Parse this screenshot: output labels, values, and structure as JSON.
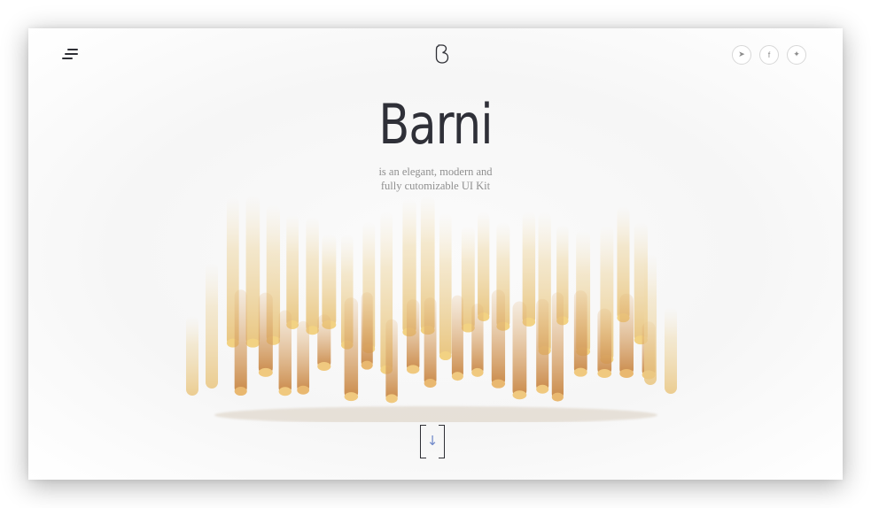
{
  "header": {
    "menu_icon": "hamburger-menu-icon",
    "logo_icon": "barni-b-logo-icon",
    "social": [
      {
        "icon": "send-icon",
        "glyph": "➤"
      },
      {
        "icon": "facebook-icon",
        "glyph": "f"
      },
      {
        "icon": "twitter-icon",
        "glyph": "✦"
      }
    ]
  },
  "hero": {
    "title": "Barni",
    "subtitle_line1": "is an elegant, modern and",
    "subtitle_line2": "fully cutomizable UI Kit",
    "image": "pasta-sticks-image",
    "scroll_icon": "arrow-down-icon",
    "scroll_glyph": "↓"
  },
  "colors": {
    "text_dark": "#2f3038",
    "text_muted": "#8f8f8f",
    "accent": "#6f88c9",
    "pasta_light": "#f1d390",
    "pasta_dark": "#c88a4a"
  }
}
